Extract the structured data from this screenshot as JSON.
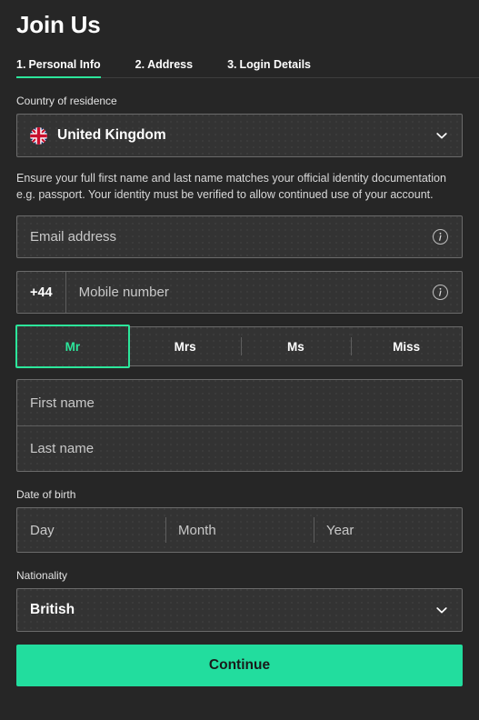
{
  "header": {
    "title": "Join Us",
    "tabs": [
      {
        "num": "1.",
        "label": "Personal Info",
        "active": true
      },
      {
        "num": "2.",
        "label": "Address",
        "active": false
      },
      {
        "num": "3.",
        "label": "Login Details",
        "active": false
      }
    ]
  },
  "country": {
    "label": "Country of residence",
    "value": "United Kingdom",
    "flag_icon": "united-kingdom-flag-icon",
    "chevron_icon": "chevron-down-icon"
  },
  "helper": {
    "text": "Ensure your full first name and last name matches your official identity documentation e.g. passport. Your identity must be verified to allow continued use of your account."
  },
  "email": {
    "placeholder": "Email address",
    "value": "",
    "info_icon": "info-icon"
  },
  "mobile": {
    "dial_code": "+44",
    "placeholder": "Mobile number",
    "value": "",
    "info_icon": "info-icon"
  },
  "title_select": {
    "options": [
      {
        "label": "Mr",
        "selected": true
      },
      {
        "label": "Mrs",
        "selected": false
      },
      {
        "label": "Ms",
        "selected": false
      },
      {
        "label": "Miss",
        "selected": false
      }
    ]
  },
  "name": {
    "first_placeholder": "First name",
    "first_value": "",
    "last_placeholder": "Last name",
    "last_value": ""
  },
  "dob": {
    "label": "Date of birth",
    "day_placeholder": "Day",
    "day_value": "",
    "month_placeholder": "Month",
    "month_value": "",
    "year_placeholder": "Year",
    "year_value": ""
  },
  "nationality": {
    "label": "Nationality",
    "value": "British",
    "chevron_icon": "chevron-down-icon"
  },
  "submit": {
    "label": "Continue"
  },
  "colors": {
    "accent_green": "#2ce69b",
    "button_green": "#22dd9e",
    "page_background": "#262626",
    "field_background": "#333333",
    "field_border": "#6b6b6b"
  }
}
